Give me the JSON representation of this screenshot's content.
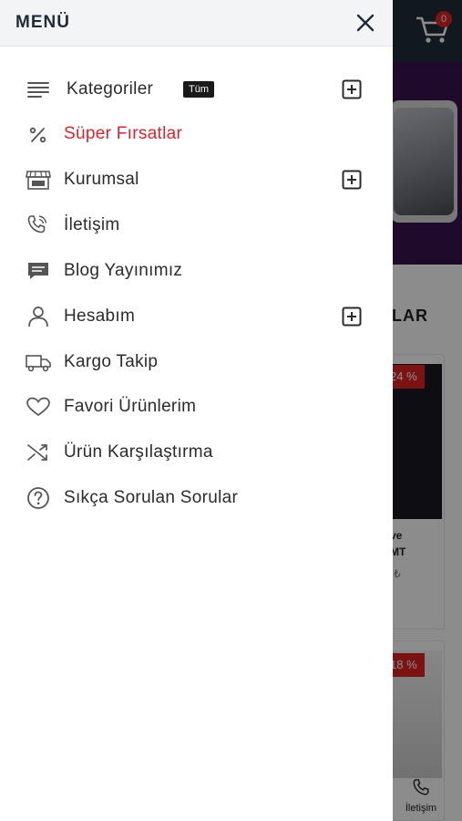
{
  "background": {
    "cart_count": "0",
    "section_title_fragment": "LAR",
    "products": [
      {
        "discount": "24 %",
        "title_line1": "ve",
        "title_line2": "MT",
        "price_fragment": "₺"
      },
      {
        "discount": "18 %"
      }
    ],
    "bottom_nav": {
      "contact_label": "İletişim"
    }
  },
  "drawer": {
    "title": "MENÜ",
    "items": [
      {
        "label": "Kategoriler",
        "badge": "Tüm",
        "icon": "list-icon",
        "expandable": true
      },
      {
        "label": "Süper Fırsatlar",
        "icon": "percent-icon",
        "highlight": true
      },
      {
        "label": "Kurumsal",
        "icon": "shop-icon",
        "expandable": true
      },
      {
        "label": "İletişim",
        "icon": "phone-icon"
      },
      {
        "label": "Blog Yayınımız",
        "icon": "chat-icon"
      },
      {
        "label": "Hesabım",
        "icon": "user-icon",
        "expandable": true
      },
      {
        "label": "Kargo Takip",
        "icon": "truck-icon"
      },
      {
        "label": "Favori Ürünlerim",
        "icon": "heart-icon"
      },
      {
        "label": "Ürün Karşılaştırma",
        "icon": "shuffle-icon"
      },
      {
        "label": "Sıkça Sorulan Sorular",
        "icon": "question-icon"
      }
    ]
  },
  "colors": {
    "highlight": "#d9232e",
    "header_bg": "#f3f4f6",
    "topbar_bg": "#1f2d3a",
    "discount_badge": "#e02424"
  }
}
